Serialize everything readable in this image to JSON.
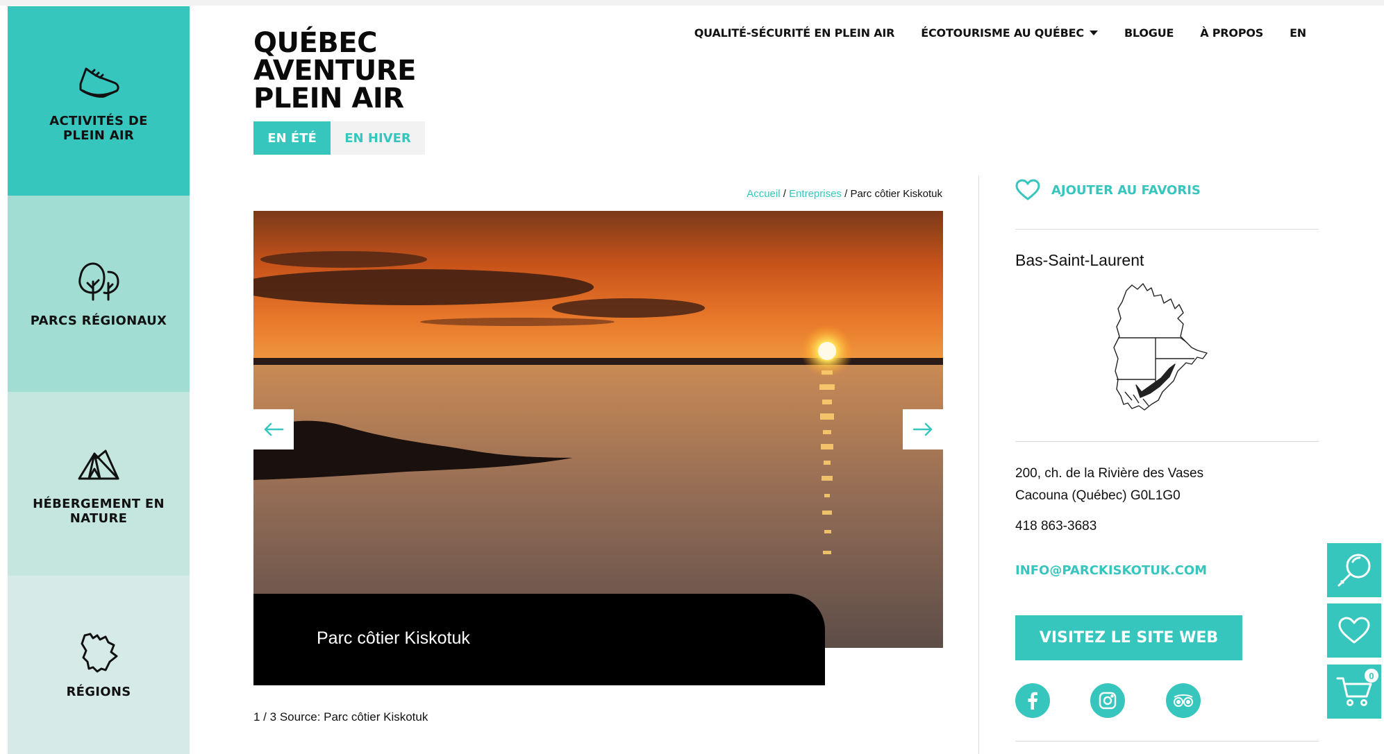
{
  "brand": {
    "logo_line1": "QUÉBEC",
    "logo_line2": "AVENTURE",
    "logo_line3": "PLEIN AIR",
    "accent": "#36c6bd"
  },
  "sidebar": {
    "items": [
      {
        "label": "ACTIVITÉS DE PLEIN AIR",
        "icon": "sneaker-icon"
      },
      {
        "label": "PARCS RÉGIONAUX",
        "icon": "trees-icon"
      },
      {
        "label": "HÉBERGEMENT EN NATURE",
        "icon": "tent-icon"
      },
      {
        "label": "RÉGIONS",
        "icon": "quebec-map-icon"
      }
    ]
  },
  "season": {
    "summer": "EN ÉTÉ",
    "winter": "EN HIVER",
    "active": "summer"
  },
  "nav": {
    "items": [
      {
        "label": "QUALITÉ-SÉCURITÉ EN PLEIN AIR"
      },
      {
        "label": "ÉCOTOURISME AU QUÉBEC"
      },
      {
        "label": "BLOGUE"
      },
      {
        "label": "À PROPOS"
      },
      {
        "label": "EN"
      }
    ]
  },
  "breadcrumb": {
    "home": "Accueil",
    "section": "Entreprises",
    "current": "Parc côtier Kiskotuk",
    "separator": "/"
  },
  "slider": {
    "caption": "Parc côtier Kiskotuk",
    "counter": "1 / 3",
    "source": "Source: Parc côtier Kiskotuk"
  },
  "listing": {
    "favorite_label": "AJOUTER AU FAVORIS",
    "region": "Bas-Saint-Laurent",
    "address_line1": "200, ch. de la Rivière des Vases",
    "address_line2": "Cacouna (Québec) G0L1G0",
    "phone": "418 863-3683",
    "email": "INFO@PARCKISKOTUK.COM",
    "website_button": "VISITEZ LE SITE WEB",
    "socials": [
      "facebook-icon",
      "instagram-icon",
      "tripadvisor-icon"
    ]
  },
  "tools": {
    "cart_count": "0"
  }
}
